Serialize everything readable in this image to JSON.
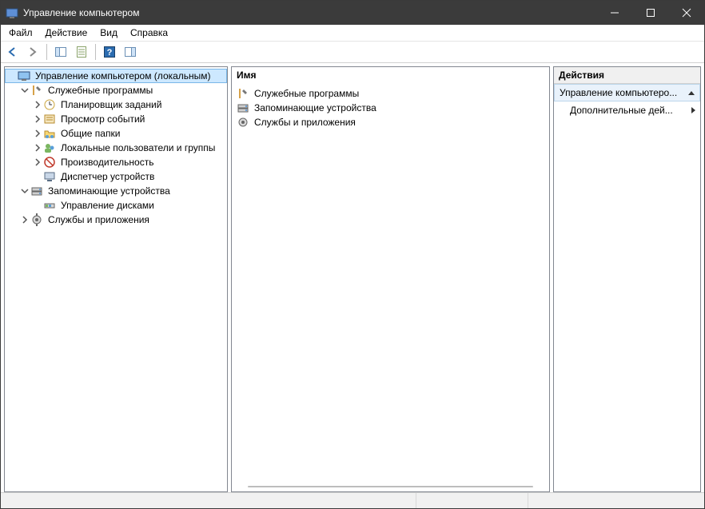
{
  "window": {
    "title": "Управление компьютером"
  },
  "menu": {
    "file": "Файл",
    "action": "Действие",
    "view": "Вид",
    "help": "Справка"
  },
  "tree": {
    "root": "Управление компьютером (локальным)",
    "system_tools": "Служебные программы",
    "task_scheduler": "Планировщик заданий",
    "event_viewer": "Просмотр событий",
    "shared_folders": "Общие папки",
    "local_users": "Локальные пользователи и группы",
    "performance": "Производительность",
    "device_manager": "Диспетчер устройств",
    "storage": "Запоминающие устройства",
    "disk_management": "Управление дисками",
    "services_apps": "Службы и приложения"
  },
  "center": {
    "header": "Имя",
    "items": {
      "system_tools": "Служебные программы",
      "storage": "Запоминающие устройства",
      "services_apps": "Службы и приложения"
    }
  },
  "actions": {
    "header": "Действия",
    "group_title": "Управление компьютеро...",
    "more": "Дополнительные дей..."
  }
}
